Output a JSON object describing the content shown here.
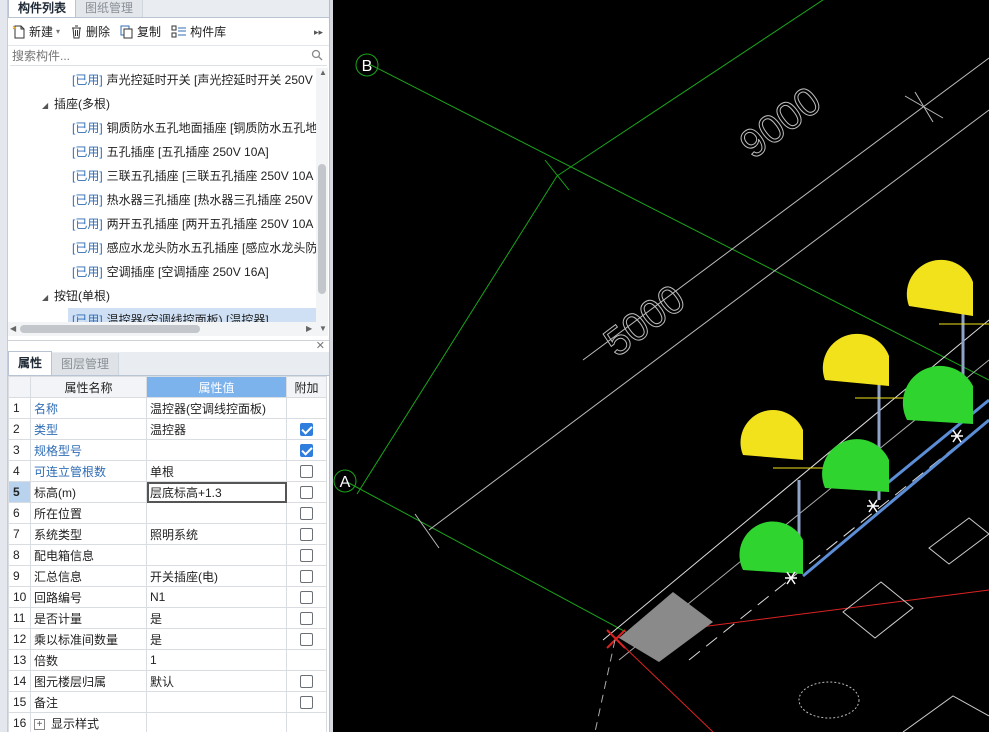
{
  "tabs": {
    "components": "构件列表",
    "drawings": "图纸管理"
  },
  "toolbar": {
    "new": "新建",
    "delete": "删除",
    "copy": "复制",
    "library": "构件库"
  },
  "search": {
    "placeholder": "搜索构件..."
  },
  "tree": {
    "used_tag": "[已用]",
    "rows": [
      {
        "kind": "child",
        "text": "声光控延时开关 [声光控延时开关 250V"
      },
      {
        "kind": "group",
        "text": "插座(多根)"
      },
      {
        "kind": "child",
        "text": "铜质防水五孔地面插座 [铜质防水五孔地"
      },
      {
        "kind": "child",
        "text": "五孔插座 [五孔插座 250V 10A]"
      },
      {
        "kind": "child",
        "text": "三联五孔插座 [三联五孔插座 250V 10A"
      },
      {
        "kind": "child",
        "text": "热水器三孔插座 [热水器三孔插座 250V"
      },
      {
        "kind": "child",
        "text": "两开五孔插座 [两开五孔插座 250V 10A"
      },
      {
        "kind": "child",
        "text": "感应水龙头防水五孔插座 [感应水龙头防"
      },
      {
        "kind": "child",
        "text": "空调插座 [空调插座 250V 16A]"
      },
      {
        "kind": "group",
        "text": "按钮(单根)"
      },
      {
        "kind": "selected",
        "text": "温控器(空调线控面板) [温控器]"
      }
    ]
  },
  "props_tabs": {
    "properties": "属性",
    "layers": "图层管理"
  },
  "props_table": {
    "headers": {
      "name": "属性名称",
      "value": "属性值",
      "extra": "附加"
    },
    "rows": [
      {
        "num": "1",
        "name": "名称",
        "value": "温控器(空调线控面板)",
        "blue": true,
        "check": "none"
      },
      {
        "num": "2",
        "name": "类型",
        "value": "温控器",
        "blue": true,
        "check": "on"
      },
      {
        "num": "3",
        "name": "规格型号",
        "value": "",
        "blue": true,
        "check": "on"
      },
      {
        "num": "4",
        "name": "可连立管根数",
        "value": "单根",
        "blue": true,
        "check": "off"
      },
      {
        "num": "5",
        "name": "标高(m)",
        "value": "层底标高+1.3",
        "blue": false,
        "check": "off"
      },
      {
        "num": "6",
        "name": "所在位置",
        "value": "",
        "blue": false,
        "check": "off"
      },
      {
        "num": "7",
        "name": "系统类型",
        "value": "照明系统",
        "blue": false,
        "check": "off"
      },
      {
        "num": "8",
        "name": "配电箱信息",
        "value": "",
        "blue": false,
        "check": "off"
      },
      {
        "num": "9",
        "name": "汇总信息",
        "value": "开关插座(电)",
        "blue": false,
        "check": "off"
      },
      {
        "num": "10",
        "name": "回路编号",
        "value": "N1",
        "blue": false,
        "check": "off"
      },
      {
        "num": "11",
        "name": "是否计量",
        "value": "是",
        "blue": false,
        "check": "off"
      },
      {
        "num": "12",
        "name": "乘以标准间数量",
        "value": "是",
        "blue": false,
        "check": "off"
      },
      {
        "num": "13",
        "name": "倍数",
        "value": "1",
        "blue": false,
        "check": "none"
      },
      {
        "num": "14",
        "name": "图元楼层归属",
        "value": "默认",
        "blue": false,
        "check": "off"
      },
      {
        "num": "15",
        "name": "备注",
        "value": "",
        "blue": false,
        "check": "off"
      },
      {
        "num": "16",
        "name": "显示样式",
        "value": "",
        "blue": false,
        "check": "none"
      }
    ]
  },
  "canvas": {
    "axis_b": "B",
    "axis_a": "A",
    "dim_top": "9000",
    "dim_mid": "5000"
  }
}
